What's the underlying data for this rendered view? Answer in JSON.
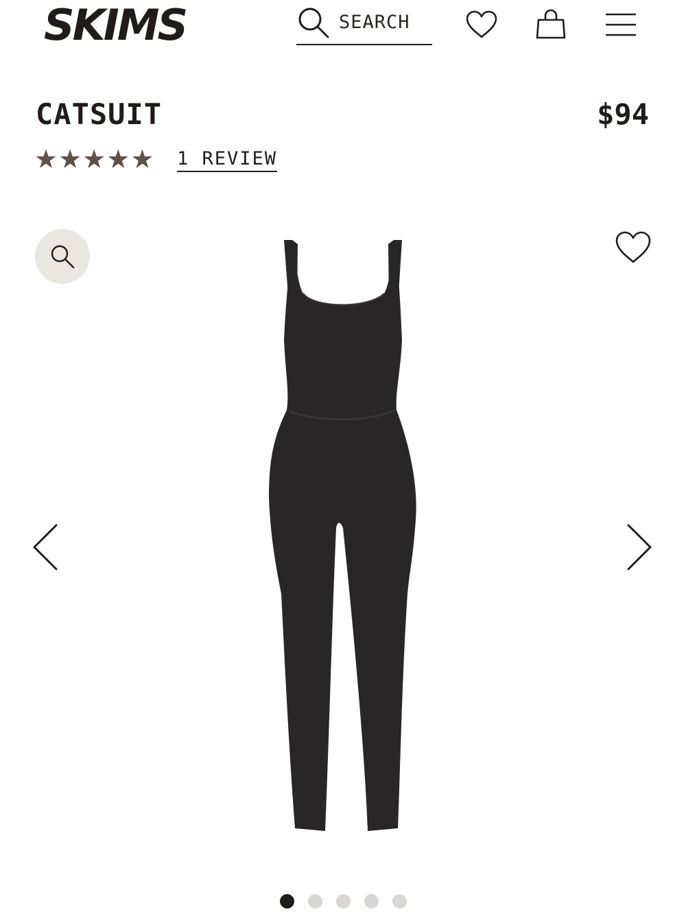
{
  "header": {
    "brand": "SKIMS",
    "search_placeholder": "SEARCH",
    "icons": [
      "search-icon",
      "heart-icon",
      "shopping-bag-icon",
      "menu-icon"
    ]
  },
  "product": {
    "title": "CATSUIT",
    "price": "$94",
    "rating": 5,
    "rating_max": 5,
    "star_glyph": "★",
    "star_color": "#5f5048",
    "reviews_label": "1 REVIEW"
  },
  "gallery": {
    "image_count": 5,
    "active_index": 0,
    "zoom_bg_color": "#ebe6df",
    "icons": [
      "zoom-icon",
      "favorite-icon",
      "chevron-left-icon",
      "chevron-right-icon"
    ]
  }
}
